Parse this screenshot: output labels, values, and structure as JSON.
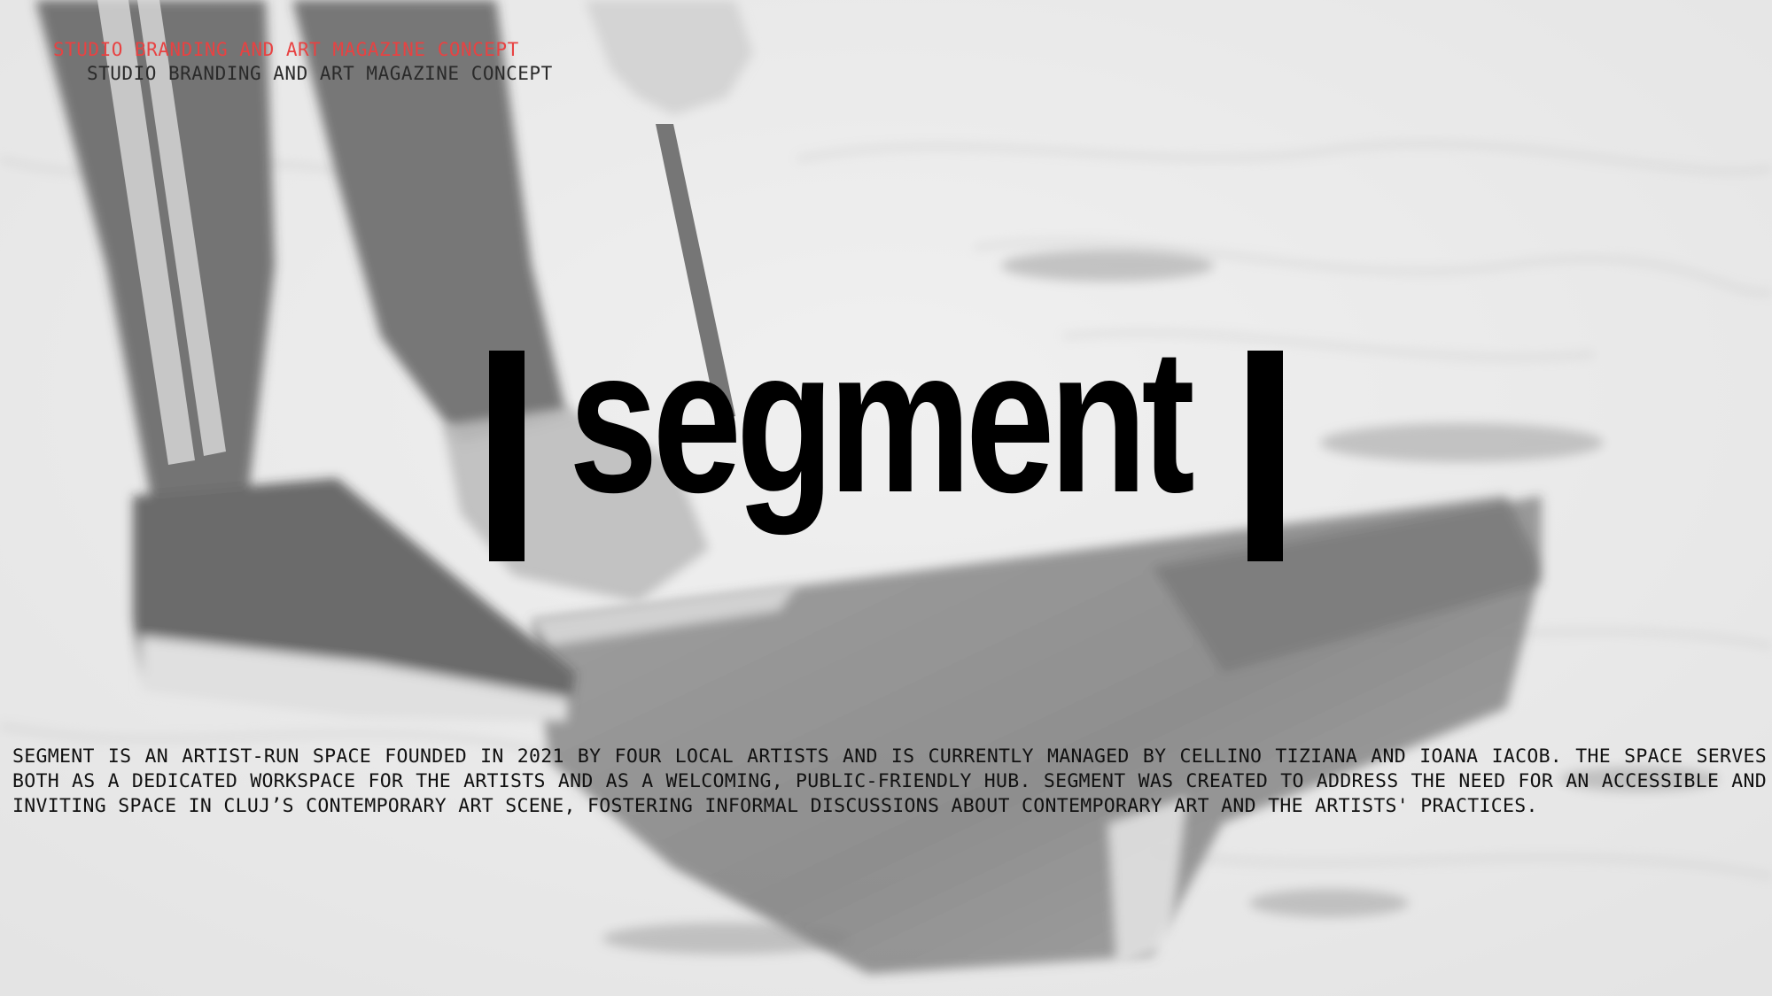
{
  "header": {
    "tagline_primary": "STUDIO BRANDING AND ART MAGAZINE CONCEPT",
    "tagline_secondary": "STUDIO BRANDING AND ART MAGAZINE CONCEPT"
  },
  "logo": {
    "word": "segment"
  },
  "description": {
    "text": "SEGMENT IS AN ARTIST-RUN SPACE FOUNDED IN 2021 BY FOUR LOCAL ARTISTS AND IS CURRENTLY MANAGED BY CELLINO TIZIANA AND IOANA IACOB. THE SPACE SERVES BOTH AS A DEDICATED WORKSPACE FOR THE ARTISTS AND AS A WELCOMING, PUBLIC-FRIENDLY HUB. SEGMENT WAS CREATED TO ADDRESS THE NEED FOR AN ACCESSIBLE AND INVITING SPACE IN CLUJ’S CONTEMPORARY ART SCENE, FOSTERING INFORMAL DISCUSSIONS ABOUT CONTEMPORARY ART AND THE ARTISTS' PRACTICES."
  },
  "colors": {
    "accent_red": "#e84242",
    "text_dark": "#2a2a2a",
    "logo_black": "#000000",
    "background_gray": "#e4e4e4"
  }
}
